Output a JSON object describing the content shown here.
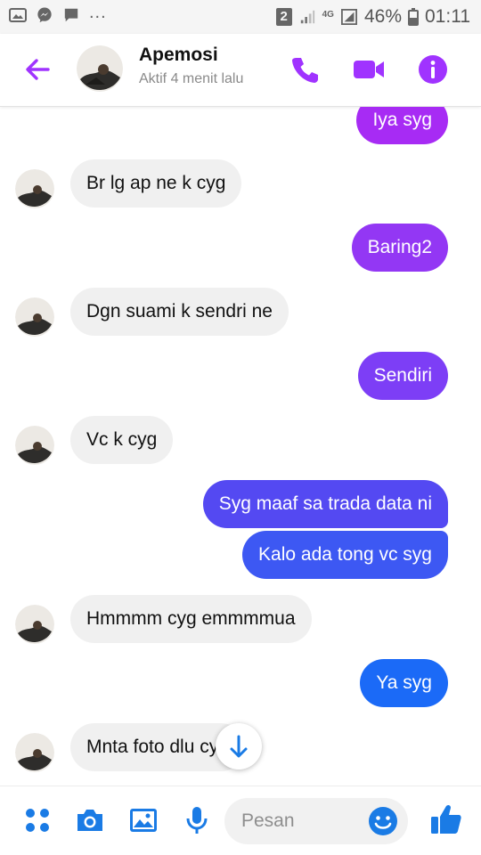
{
  "status_bar": {
    "sim_slot": "2",
    "network": "4G",
    "battery": "46%",
    "time": "01:11",
    "overflow": "..."
  },
  "header": {
    "contact_name": "Apemosi",
    "status": "Aktif 4 menit lalu",
    "icons": [
      "back-arrow-icon",
      "phone-icon",
      "video-camera-icon",
      "info-icon"
    ],
    "accent_color": "#a033ff"
  },
  "messages": [
    {
      "dir": "out",
      "text": "Iya syg",
      "color": "#a72bf4"
    },
    {
      "dir": "in",
      "text": "Br lg ap ne k cyg"
    },
    {
      "dir": "out",
      "text": "Baring2",
      "color": "#9337f4"
    },
    {
      "dir": "in",
      "text": "Dgn suami k sendri ne"
    },
    {
      "dir": "out",
      "text": "Sendiri",
      "color": "#7d3ef6"
    },
    {
      "dir": "in",
      "text": "Vc k cyg"
    },
    {
      "dir": "out",
      "text": "Syg maaf sa trada data ni",
      "color": "#5449f2"
    },
    {
      "dir": "out",
      "text": "Kalo ada tong vc syg",
      "color": "#3d58f3"
    },
    {
      "dir": "in",
      "text": "Hmmmm cyg emmmmua"
    },
    {
      "dir": "out",
      "text": "Ya syg",
      "color": "#1b6af7"
    },
    {
      "dir": "in",
      "text": "Mnta foto dlu cyg"
    }
  ],
  "composer": {
    "placeholder": "Pesan",
    "icons": [
      "apps-grid-icon",
      "camera-icon",
      "gallery-icon",
      "microphone-icon",
      "emoji-icon",
      "thumbs-up-icon"
    ],
    "icon_color": "#1a7be5"
  }
}
